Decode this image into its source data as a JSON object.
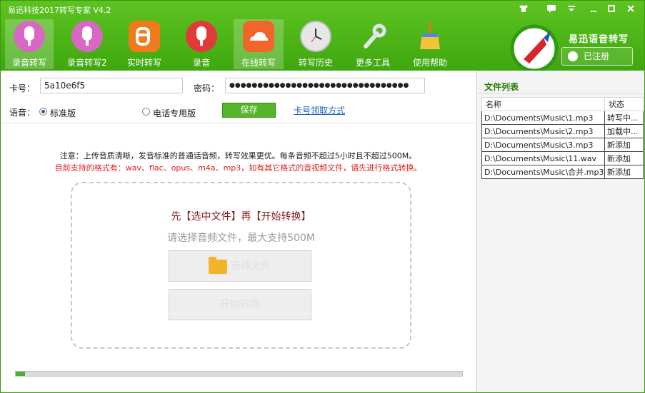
{
  "window": {
    "title": "易迅科技2017转写专家 V4.2",
    "controls": [
      "shirt-icon",
      "message-icon",
      "menu-icon",
      "minimize-icon",
      "maximize-icon",
      "close-icon"
    ]
  },
  "toolbar": {
    "items": [
      {
        "label": "录音转写",
        "icon": "microphone-icon",
        "color": "#d968c4",
        "active": true
      },
      {
        "label": "录音转写2",
        "icon": "microphone-icon",
        "color": "#d968c4",
        "active": false
      },
      {
        "label": "实时转写",
        "icon": "blogger-icon",
        "color": "#f07b1c",
        "active": false
      },
      {
        "label": "录音",
        "icon": "microphone-icon",
        "color": "#e23a3a",
        "active": false
      },
      {
        "label": "在线转写",
        "icon": "cloud-icon",
        "color": "#f0652a",
        "active": true
      },
      {
        "label": "转写历史",
        "icon": "clock-icon",
        "color": "#d9d9d9",
        "active": false
      },
      {
        "label": "更多工具",
        "icon": "wrench-icon",
        "color": "#cfd8e0",
        "active": false
      },
      {
        "label": "使用帮助",
        "icon": "broom-icon",
        "color": "#f2c23a",
        "active": false
      }
    ]
  },
  "brand": {
    "name": "易迅语音转写",
    "register_label": "已注册"
  },
  "form": {
    "card_label": "卡号：",
    "card_value": "5a10e6f5",
    "password_label": "密码：",
    "password_value": "●●●●●●●●●●●●●●●●●●●●●●●●●●●●●●●●",
    "voice_label": "语音：",
    "radio_standard": "标准版",
    "radio_phone": "电话专用版",
    "save_label": "保存",
    "card_link": "卡号领取方式"
  },
  "notes": {
    "line1": "注意：上传音质清晰，发音标准的普通话音频，转写效果更优。每条音频不超过5小时且不超过500M。",
    "line2": "目前支持的格式有：wav、flac、opus、m4a、mp3，如有其它格式的音视频文件，请先进行格式转换。"
  },
  "upload": {
    "title": "先【选中文件】再【开始转换】",
    "hint": "请选择音频文件，最大支持500M",
    "select_label": "选择文件",
    "start_label": "开始转换"
  },
  "progress": {
    "fraction": 0.02
  },
  "file_list": {
    "title": "文件列表",
    "col_name": "名称",
    "col_status": "状态",
    "rows": [
      {
        "name": "D:\\Documents\\Music\\1.mp3",
        "status": "转写中..."
      },
      {
        "name": "D:\\Documents\\Music\\2.mp3",
        "status": "加载中..."
      },
      {
        "name": "D:\\Documents\\Music\\3.mp3",
        "status": "新添加"
      },
      {
        "name": "D:\\Documents\\Music\\11.wav",
        "status": "新添加"
      },
      {
        "name": "D:\\Documents\\Music\\合并.mp3",
        "status": "新添加"
      }
    ]
  }
}
